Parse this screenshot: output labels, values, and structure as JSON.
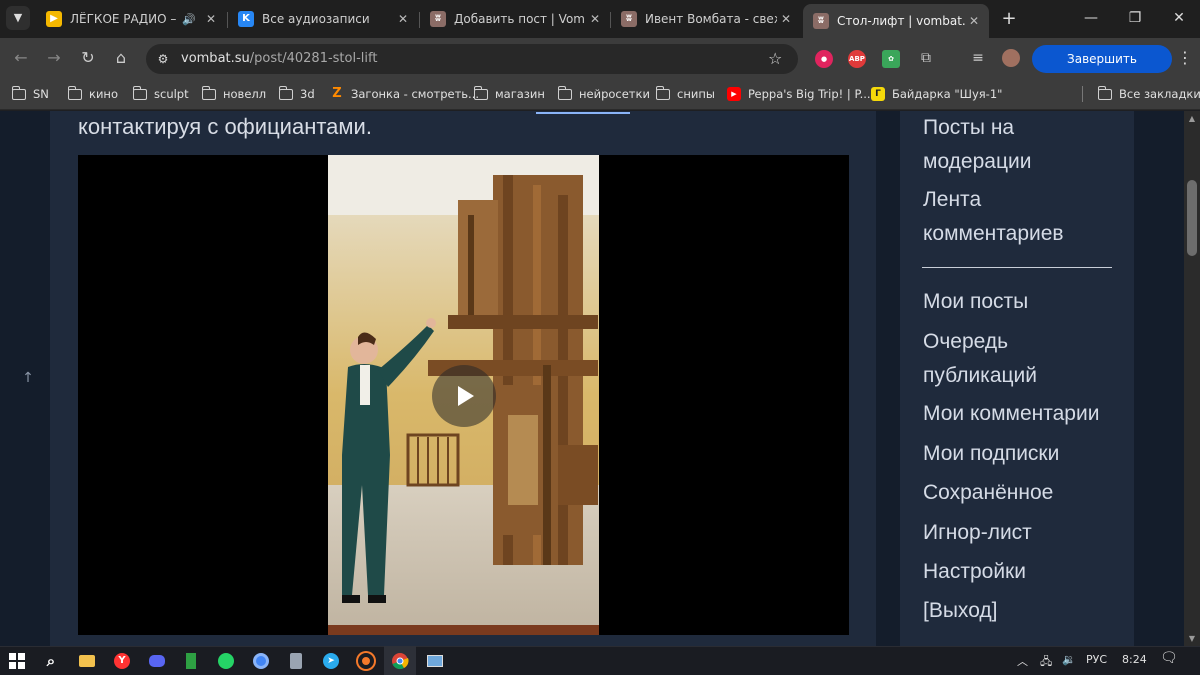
{
  "tabs": [
    {
      "title": "ЛЁГКОЕ РАДИО – сл",
      "favicon": "yandex-music-icon",
      "color": "#f5b800",
      "playing": true,
      "active": false
    },
    {
      "title": "Все аудиозаписи",
      "favicon": "vk-icon",
      "color": "#2787f5",
      "active": false
    },
    {
      "title": "Добавить пост | Vombat",
      "favicon": "vombat-icon",
      "color": "#8b6c66",
      "active": false
    },
    {
      "title": "Ивент Вомбата - свежие",
      "favicon": "vombat-icon",
      "color": "#8b6c66",
      "active": false
    },
    {
      "title": "Стол-лифт | vombat.su",
      "favicon": "vombat-icon",
      "color": "#8b6c66",
      "active": true
    }
  ],
  "address": {
    "host": "vombat.su",
    "path": "/post/40281-stol-lift"
  },
  "toolbar": {
    "update_label": "Завершить обновление"
  },
  "extensions": [
    {
      "name": "record-extension-icon",
      "color": "#e0245e",
      "text": ""
    },
    {
      "name": "adblock-icon",
      "color": "#e03a3a",
      "text": "ABP"
    },
    {
      "name": "color-extension-icon",
      "color": "#3aa65a",
      "text": ""
    }
  ],
  "bookmarks": [
    {
      "label": "SN",
      "type": "folder"
    },
    {
      "label": "кино",
      "type": "folder"
    },
    {
      "label": "sculpt",
      "type": "folder"
    },
    {
      "label": "новелл",
      "type": "folder"
    },
    {
      "label": "3d",
      "type": "folder"
    },
    {
      "label": "Загонка - смотреть...",
      "type": "link",
      "icon": "zagonka-icon",
      "color": "#ff8a00",
      "glyph": "Z"
    },
    {
      "label": "магазин",
      "type": "folder"
    },
    {
      "label": "нейросетки",
      "type": "folder"
    },
    {
      "label": "снипы",
      "type": "folder"
    },
    {
      "label": "Peppa's Big Trip! | P...",
      "type": "link",
      "icon": "youtube-icon",
      "color": "#ff0000",
      "glyph": "▶"
    },
    {
      "label": "Байдарка \"Шуя-1\"",
      "type": "link",
      "icon": "bookmark-site-icon",
      "color": "#f5d90a",
      "glyph": "Г"
    }
  ],
  "bookmarks_all_label": "Все закладки",
  "post": {
    "text": "контактируя с официантами."
  },
  "sidebar": {
    "group1": [
      "Посты на модерации",
      "Лента комментариев"
    ],
    "group2": [
      "Мои посты",
      "Очередь публикаций",
      "Мои комментарии",
      "Мои подписки",
      "Сохранённое",
      "Игнор-лист",
      "Настройки",
      "[Выход]"
    ]
  },
  "taskbar": {
    "apps": [
      {
        "name": "start-icon",
        "color": "#ffffff"
      },
      {
        "name": "search-icon",
        "color": "#ffffff"
      },
      {
        "name": "file-explorer-icon",
        "color": "#f2c14e"
      },
      {
        "name": "yandex-browser-icon",
        "color": "#ff3333"
      },
      {
        "name": "discord-icon",
        "color": "#5865f2"
      },
      {
        "name": "app-green-icon",
        "color": "#2ea043"
      },
      {
        "name": "whatsapp-icon",
        "color": "#25d366"
      },
      {
        "name": "app-blue-icon",
        "color": "#4285f4"
      },
      {
        "name": "calculator-icon",
        "color": "#9aa4b2"
      },
      {
        "name": "telegram-icon",
        "color": "#2aabee"
      },
      {
        "name": "blender-icon",
        "color": "#f5792a"
      },
      {
        "name": "chrome-icon",
        "color": "#34a853"
      },
      {
        "name": "photos-icon",
        "color": "#6fa8dc"
      }
    ],
    "lang": "РУС",
    "time": "8:24"
  }
}
